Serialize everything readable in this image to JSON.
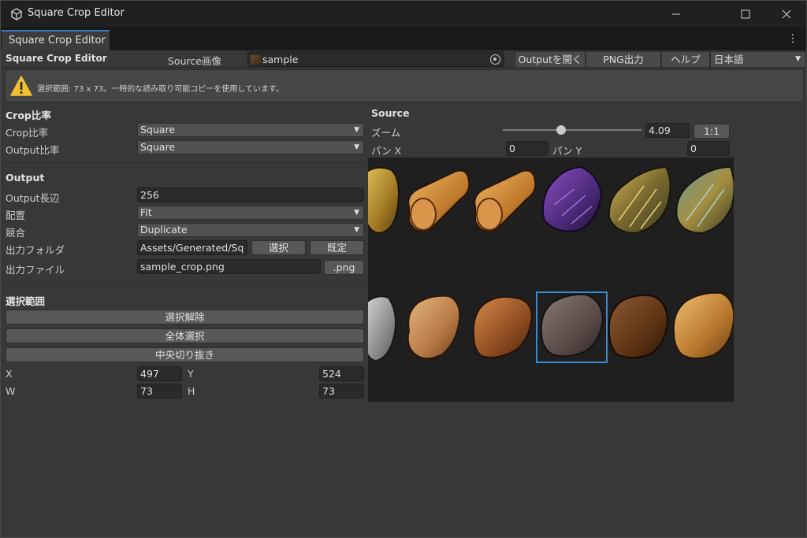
{
  "window": {
    "title": "Square Crop Editor",
    "tab": "Square Crop Editor"
  },
  "toolbar": {
    "title": "Square Crop Editor",
    "source_label": "Source画像",
    "source_value": "sample",
    "open_output": "Outputを開く",
    "png_export": "PNG出力",
    "help": "ヘルプ",
    "language": "日本語"
  },
  "helpbox": {
    "text": "選択範囲: 73 x 73。一時的な読み取り可能コピーを使用しています。"
  },
  "crop": {
    "section": "Crop比率",
    "crop_ratio_label": "Crop比率",
    "crop_ratio_value": "Square",
    "output_ratio_label": "Output比率",
    "output_ratio_value": "Square"
  },
  "output": {
    "section": "Output",
    "long_edge_label": "Output長辺",
    "long_edge_value": "256",
    "placement_label": "配置",
    "placement_value": "Fit",
    "conflict_label": "競合",
    "conflict_value": "Duplicate",
    "folder_label": "出力フォルダ",
    "folder_value": "Assets/Generated/Sq",
    "folder_select": "選択",
    "folder_default": "既定",
    "file_label": "出力ファイル",
    "file_value": "sample_crop.png",
    "ext_button": ".png"
  },
  "selection": {
    "section": "選択範囲",
    "clear": "選択解除",
    "select_all": "全体選択",
    "center_crop": "中央切り抜き",
    "x_label": "X",
    "x_value": "497",
    "y_label": "Y",
    "y_value": "524",
    "w_label": "W",
    "w_value": "73",
    "h_label": "H",
    "h_value": "73"
  },
  "source": {
    "section": "Source",
    "zoom_label": "ズーム",
    "zoom_value": "4.09",
    "zoom_fraction": 0.42,
    "one_to_one": "1:1",
    "pan_x_label": "パン X",
    "pan_x_value": "0",
    "pan_y_label": "パン Y",
    "pan_y_value": "0"
  },
  "colors": {
    "accent": "#3b8ad0",
    "warning": "#f2c12e"
  }
}
